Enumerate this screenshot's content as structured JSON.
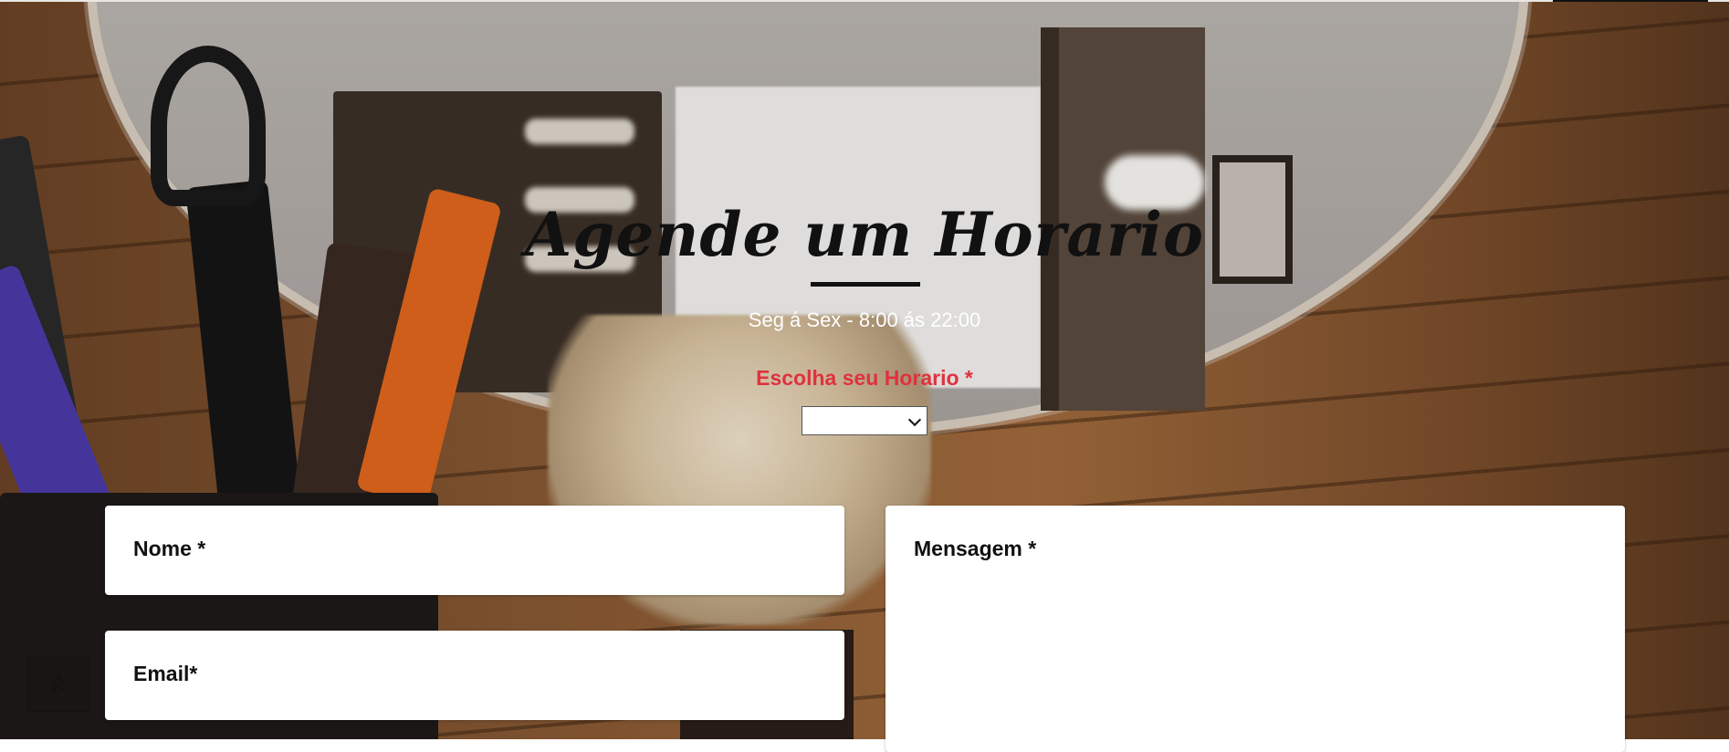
{
  "header": {
    "title": "Agende um Horario",
    "hours": "Seg á Sex - 8:00 ás 22:00"
  },
  "schedule": {
    "label": "Escolha seu Horario *",
    "selected_value": ""
  },
  "form": {
    "name_label": "Nome *",
    "email_label": "Email*",
    "message_label": "Mensagem *"
  },
  "colors": {
    "accent": "#e0313e",
    "title": "#111111",
    "hours_text": "#ffffff"
  },
  "icons": {
    "scroll_top": "double-chevron-up-icon"
  }
}
